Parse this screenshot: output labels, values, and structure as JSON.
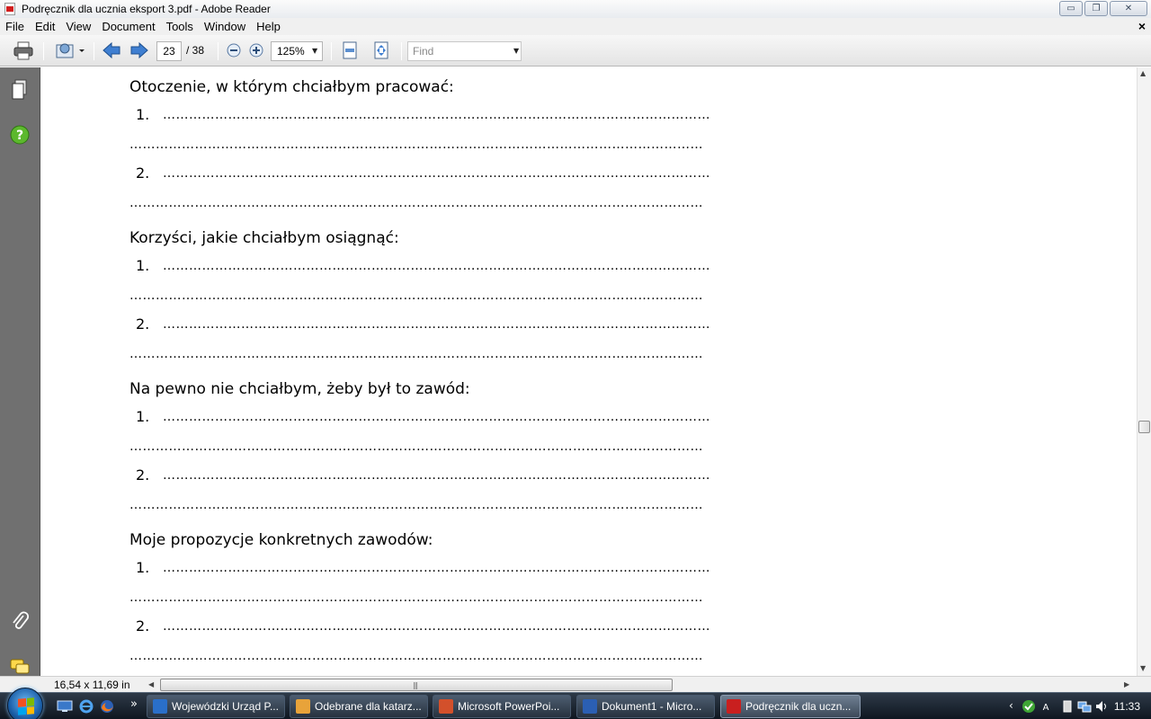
{
  "window": {
    "title": "Podręcznik dla ucznia eksport 3.pdf - Adobe Reader",
    "buttons": {
      "minimize": "▭",
      "restore": "❐",
      "close": "✕"
    }
  },
  "menu": {
    "items": [
      "File",
      "Edit",
      "View",
      "Document",
      "Tools",
      "Window",
      "Help"
    ],
    "doc_close": "×"
  },
  "toolbar": {
    "page_current": "23",
    "page_total": "/  38",
    "zoom": "125%",
    "find_placeholder": "Find"
  },
  "document": {
    "dots_full": "……………………………………………………………………………………………………………………",
    "dots_short": "………………………………………………………………………………………………………………",
    "sections": [
      {
        "heading": "Otoczenie, w którym chciałbym pracować:",
        "items": [
          "1.",
          "2."
        ]
      },
      {
        "heading": "Korzyści, jakie chciałbym osiągnąć:",
        "items": [
          "1.",
          "2."
        ]
      },
      {
        "heading": "Na pewno nie chciałbym, żeby był to zawód:",
        "items": [
          "1.",
          "2."
        ]
      },
      {
        "heading": "Moje propozycje konkretnych zawodów:",
        "items": [
          "1.",
          "2."
        ]
      }
    ]
  },
  "status": {
    "page_size": "16,54 x 11,69 in"
  },
  "taskbar": {
    "buttons": [
      {
        "label": "Wojewódzki Urząd P...",
        "color": "#2a6fc9"
      },
      {
        "label": "Odebrane dla katarz...",
        "color": "#e8a33a"
      },
      {
        "label": "Microsoft PowerPoi...",
        "color": "#d3502b"
      },
      {
        "label": "Dokument1 - Micro...",
        "color": "#2b5fb3"
      },
      {
        "label": "Podręcznik dla uczn...",
        "color": "#c91f1f"
      }
    ],
    "clock": "11:33",
    "more": "»"
  }
}
